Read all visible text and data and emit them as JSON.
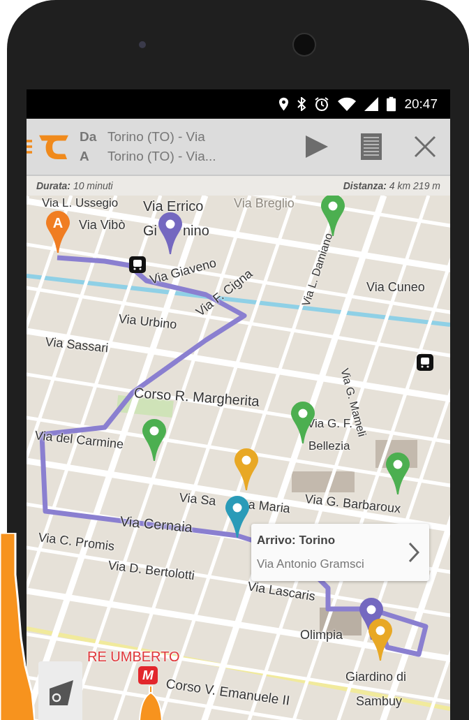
{
  "status_bar": {
    "time": "20:47"
  },
  "header": {
    "from_label": "Da",
    "from_value": "Torino (TO) - Via",
    "to_label": "A",
    "to_value": "Torino (TO) - Via..."
  },
  "route_info": {
    "duration": "**Durata:** 10 minuti",
    "distance": "**Distanza:** 4 km 219 m"
  },
  "map": {
    "labels": [
      {
        "text": "Via L. Ussegio",
        "kind": "street"
      },
      {
        "text": "Via Errico",
        "kind": "street"
      },
      {
        "text": "Via Breglio",
        "kind": "faded"
      },
      {
        "text": "Gi",
        "kind": "street"
      },
      {
        "text": "nino",
        "kind": "street"
      },
      {
        "text": "Via Vibò",
        "kind": "street"
      },
      {
        "text": "Via Giaveno",
        "kind": "street"
      },
      {
        "text": "Via L. Damiano",
        "kind": "street"
      },
      {
        "text": "Via Cuneo",
        "kind": "street"
      },
      {
        "text": "Via Urbino",
        "kind": "street"
      },
      {
        "text": "Via F. Cigna",
        "kind": "street"
      },
      {
        "text": "Via Sassari",
        "kind": "street"
      },
      {
        "text": "Via G. Mameli",
        "kind": "street"
      },
      {
        "text": "Corso R. Margherita",
        "kind": "street"
      },
      {
        "text": "Via G. F.",
        "kind": "street"
      },
      {
        "text": "Bellezia",
        "kind": "street"
      },
      {
        "text": "Via del Carmine",
        "kind": "street"
      },
      {
        "text": "Via Sa",
        "kind": "street"
      },
      {
        "text": "a Maria",
        "kind": "street"
      },
      {
        "text": "Via G. Barbaroux",
        "kind": "street"
      },
      {
        "text": "Via Cernaia",
        "kind": "street"
      },
      {
        "text": "Via C. Promis",
        "kind": "street"
      },
      {
        "text": "Via D. Bertolotti",
        "kind": "street"
      },
      {
        "text": "Via Lascaris",
        "kind": "street"
      },
      {
        "text": "Olimpia",
        "kind": "place"
      },
      {
        "text": "RE UMBERTO",
        "kind": "station"
      },
      {
        "text": "Corso V. Emanuele II",
        "kind": "street"
      },
      {
        "text": "Giardino di",
        "kind": "place"
      },
      {
        "text": "Sambuy",
        "kind": "place"
      }
    ],
    "pins": [
      {
        "color": "#f07d22",
        "letter": "A"
      },
      {
        "color": "#7468c0"
      },
      {
        "color": "#4caf50"
      },
      {
        "color": "#4caf50"
      },
      {
        "color": "#4caf50"
      },
      {
        "color": "#e8a825"
      },
      {
        "color": "#2a9bb8"
      },
      {
        "color": "#4caf50"
      },
      {
        "color": "#7468c0"
      },
      {
        "color": "#e8a825"
      }
    ],
    "metro_badge": "M",
    "popup": {
      "title": "Arrivo: Torino",
      "subtitle": "Via Antonio Gramsci"
    }
  }
}
